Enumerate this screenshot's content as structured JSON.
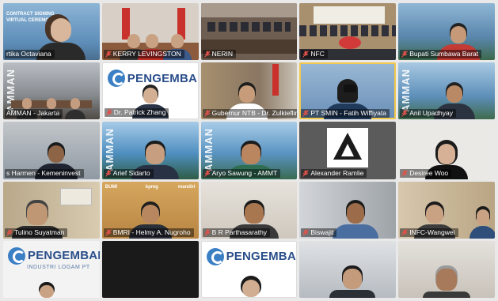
{
  "participants": [
    {
      "name": "rtika Octaviana",
      "bg": "#6f9fc8"
    },
    {
      "name": "KERRY LEVINGSTON",
      "bg": "#c9c0b5"
    },
    {
      "name": "NERIN",
      "bg": "#7d6a5a"
    },
    {
      "name": "NFC",
      "bg": "#a88c6c"
    },
    {
      "name": "Bupati Sumbawa Barat",
      "bg": "#6f98c2"
    },
    {
      "name": "AMMAN - Jakarta",
      "bg": "#8a8e93"
    },
    {
      "name": "Dr. Patrick Zhang",
      "bg": "#ffffff"
    },
    {
      "name": "Gubernur NTB - Dr. Zulkieflimansyah",
      "bg": "#9d8a78"
    },
    {
      "name": "PT SMIN - Fatih Wiffiyata",
      "bg": "#6a8fb7"
    },
    {
      "name": "Anil Upadhyay",
      "bg": "#7aa6c8"
    },
    {
      "name": "s Harmen - Kemeninvest",
      "bg": "#8f99a3"
    },
    {
      "name": "Arief Sidarto",
      "bg": "#4f8fc0"
    },
    {
      "name": "Aryo Sawung - AMMT",
      "bg": "#5a94c2"
    },
    {
      "name": "Alexander Ramlie",
      "bg": "#5b5b5b"
    },
    {
      "name": "Desiree Woo",
      "bg": "#e8e6e3"
    },
    {
      "name": "Tulino Suyatman",
      "bg": "#b9a88a"
    },
    {
      "name": "BMRI - Helmy A. Nugroho",
      "bg": "#c99a52"
    },
    {
      "name": "B R Parthasarathy",
      "bg": "#d7d2c9"
    },
    {
      "name": "Biswajit",
      "bg": "#b5b9be"
    },
    {
      "name": "INFC-Wangwei",
      "bg": "#c9b89f"
    },
    {
      "name": "",
      "bg": "#f3f3f3"
    },
    {
      "name": "",
      "bg": "#1a1a1a"
    },
    {
      "name": "",
      "bg": "#ffffff"
    },
    {
      "name": "",
      "bg": "#c7cbd0"
    },
    {
      "name": "",
      "bg": "#d9d5cf"
    }
  ],
  "overlay_text": {
    "contract_signing": "CONTRACT SIGNING\nVIRTUAL CEREMONY",
    "pengembangan": "PENGEMBANGAN",
    "pengembangan_sub": "INDUSTRI LOGAM PT",
    "amman": "AMMAN",
    "bumi_resources": "BUMI",
    "kpmg": "kpmg",
    "mandiri": "mandiri"
  },
  "colors": {
    "speaker_highlight": "#f2c94c",
    "label_bg": "rgba(0,0,0,0.45)",
    "mic_muted": "#e0524a"
  }
}
